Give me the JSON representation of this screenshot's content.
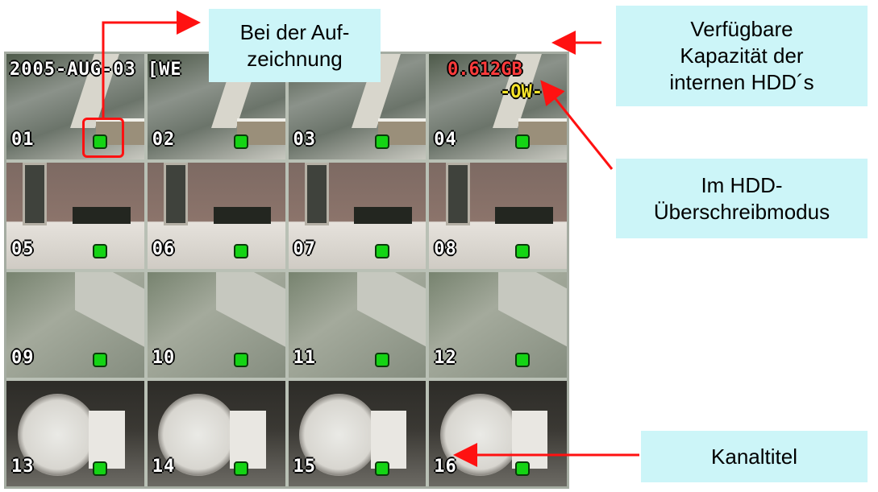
{
  "overlay": {
    "datetime": "2005-AUG-03 [WE",
    "capacity": "0.612GB",
    "overwrite_indicator": "-OW-"
  },
  "channels": [
    {
      "label": "01",
      "scene": "hall"
    },
    {
      "label": "02",
      "scene": "hall"
    },
    {
      "label": "03",
      "scene": "hall"
    },
    {
      "label": "04",
      "scene": "hall"
    },
    {
      "label": "05",
      "scene": "lobby"
    },
    {
      "label": "06",
      "scene": "lobby"
    },
    {
      "label": "07",
      "scene": "lobby"
    },
    {
      "label": "08",
      "scene": "lobby"
    },
    {
      "label": "09",
      "scene": "ceiling"
    },
    {
      "label": "10",
      "scene": "ceiling"
    },
    {
      "label": "11",
      "scene": "ceiling"
    },
    {
      "label": "12",
      "scene": "ceiling"
    },
    {
      "label": "13",
      "scene": "clock"
    },
    {
      "label": "14",
      "scene": "clock"
    },
    {
      "label": "15",
      "scene": "clock"
    },
    {
      "label": "16",
      "scene": "clock"
    }
  ],
  "callouts": {
    "recording": "Bei der Auf-\nzeichnung",
    "capacity": "Verfügbare\nKapazität der\ninternen HDD´s",
    "overwrite": "Im HDD-\nÜberschreibmodus",
    "channel_title": "Kanaltitel"
  },
  "colors": {
    "callout_bg": "#ccf5f8",
    "arrow": "#ff1111",
    "recording_indicator": "#14d414",
    "capacity_text": "#ff3b3b",
    "overwrite_text": "#f6e42a"
  }
}
